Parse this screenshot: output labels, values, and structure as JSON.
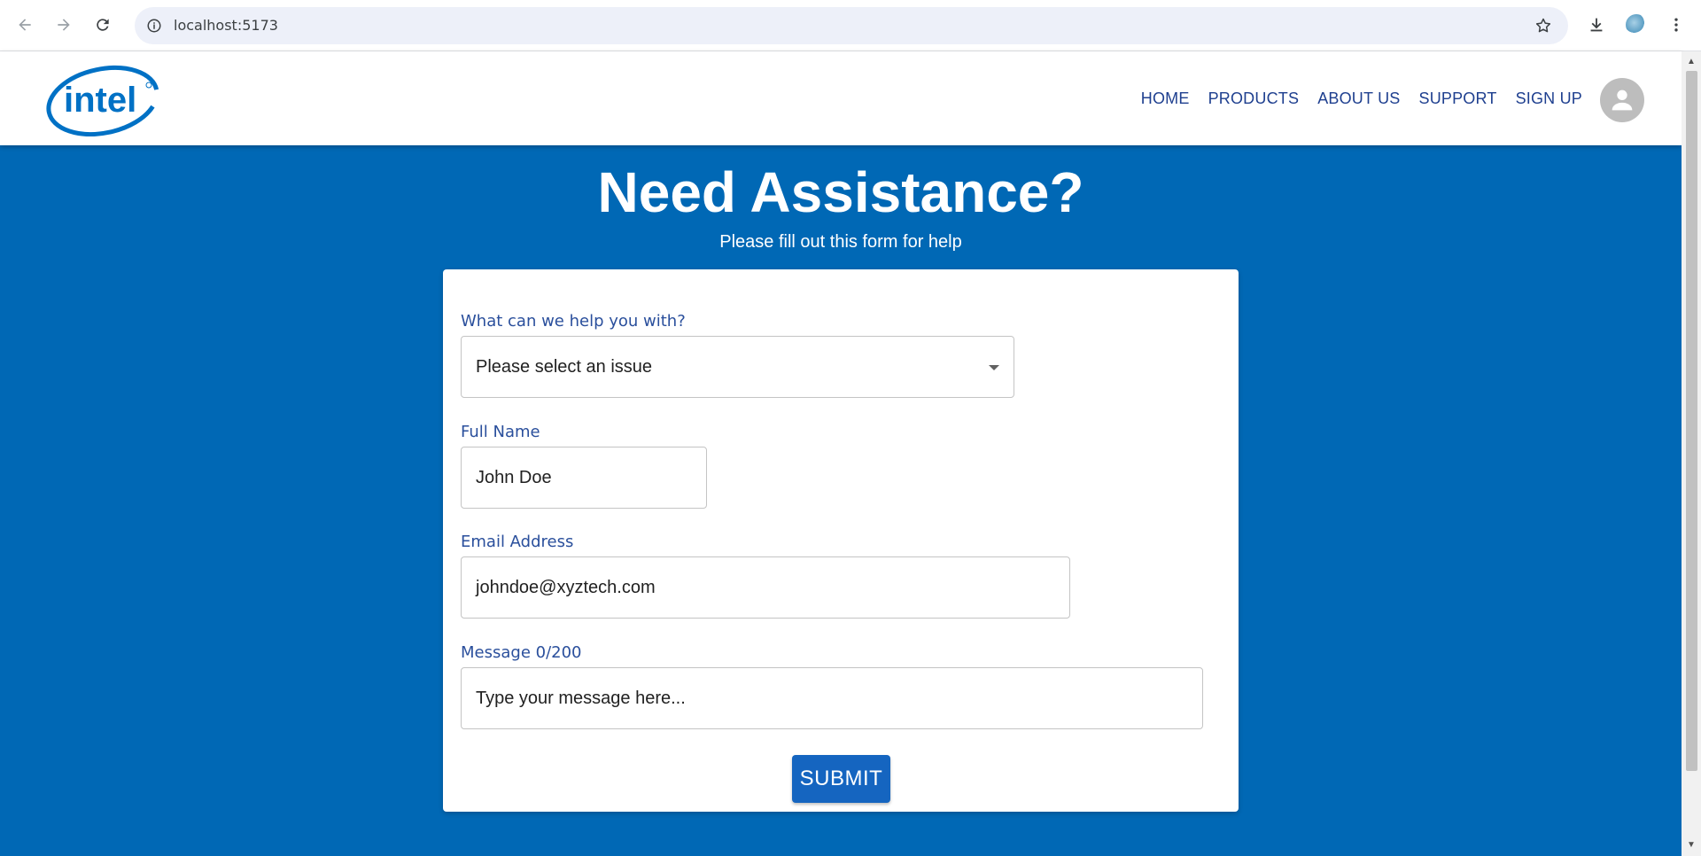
{
  "browser": {
    "url": "localhost:5173"
  },
  "header": {
    "logo_text": "intel",
    "nav": [
      {
        "label": "HOME"
      },
      {
        "label": "PRODUCTS"
      },
      {
        "label": "ABOUT US"
      },
      {
        "label": "SUPPORT"
      },
      {
        "label": "SIGN UP"
      }
    ]
  },
  "hero": {
    "title": "Need Assistance?",
    "subtitle": "Please fill out this form for help"
  },
  "form": {
    "issue": {
      "label": "What can we help you with?",
      "value": "Please select an issue"
    },
    "name": {
      "label": "Full Name",
      "value": "John Doe"
    },
    "email": {
      "label": "Email Address",
      "value": "johndoe@xyztech.com"
    },
    "message": {
      "label": "Message 0/200",
      "placeholder": "Type your message here..."
    },
    "submit_label": "SUBMIT"
  },
  "colors": {
    "page_background": "#0068b5",
    "nav_text": "#1e3f8f",
    "label_text": "#2a4f9c",
    "button": "#1565c0",
    "logo": "#0071c5"
  },
  "icons": {
    "back": "arrow-left-icon",
    "forward": "arrow-right-icon",
    "reload": "reload-icon",
    "site_info": "info-icon",
    "bookmark": "star-icon",
    "download": "download-icon",
    "menu": "kebab-menu-icon",
    "account": "person-icon",
    "dropdown": "chevron-down-icon"
  }
}
